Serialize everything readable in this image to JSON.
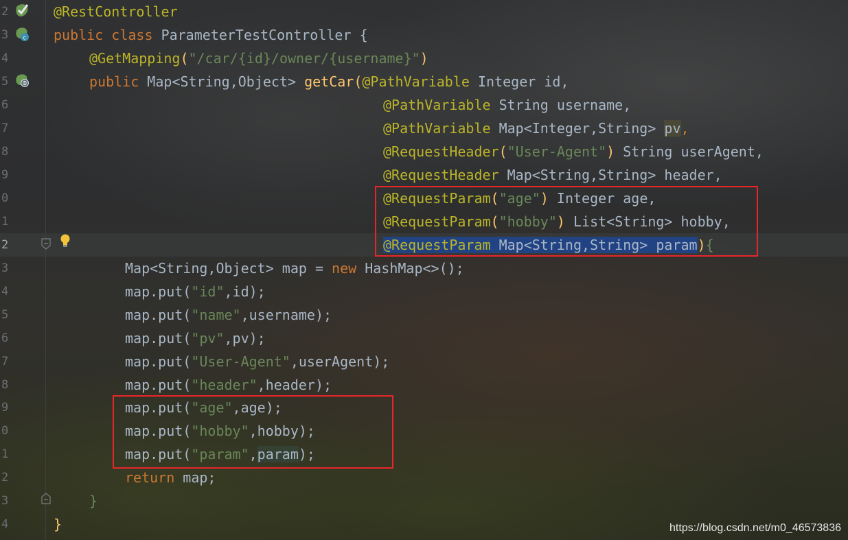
{
  "gutter": {
    "line_numbers": [
      "2",
      "3",
      "4",
      "5",
      "6",
      "7",
      "8",
      "9",
      "0",
      "1",
      "2",
      "3",
      "4",
      "5",
      "6",
      "7",
      "8",
      "9",
      "0",
      "1",
      "2",
      "3",
      "4"
    ]
  },
  "code": {
    "l2": {
      "annot": "@RestController"
    },
    "l3": {
      "kw1": "public",
      "kw2": "class",
      "name": "ParameterTestController",
      "brace": "{"
    },
    "l4": {
      "annot": "@GetMapping",
      "open": "(",
      "str": "\"/car/{id}/owner/{username}\"",
      "close": ")"
    },
    "l5": {
      "kw": "public",
      "type": "Map<String,Object>",
      "fn": "getCar",
      "open": "(",
      "annot": "@PathVariable",
      "rest": "Integer id,"
    },
    "l6": {
      "annot": "@PathVariable",
      "rest": "String username,"
    },
    "l7": {
      "annot": "@PathVariable",
      "type": "Map<Integer,String>",
      "var": "pv",
      "comma": ","
    },
    "l8": {
      "annot": "@RequestHeader",
      "open": "(",
      "str": "\"User-Agent\"",
      "close": ")",
      "rest": "String userAgent,"
    },
    "l9": {
      "annot": "@RequestHeader",
      "rest": "Map<String,String> header,"
    },
    "l10": {
      "annot": "@RequestParam",
      "open": "(",
      "str": "\"age\"",
      "close": ")",
      "rest": "Integer age,"
    },
    "l11": {
      "annot": "@RequestParam",
      "open": "(",
      "str": "\"hobby\"",
      "close": ")",
      "rest": "List<String> hobby,"
    },
    "l12": {
      "annot": "@RequestParam",
      "rest": "Map<String,String> param",
      "close": ")",
      "brace": "{"
    },
    "l13": {
      "pre": "Map<String,Object> map = ",
      "kw": "new",
      "post": "HashMap<>();"
    },
    "l14": {
      "pre": "map.put(",
      "str": "\"id\"",
      "post": ",id);"
    },
    "l15": {
      "pre": "map.put(",
      "str": "\"name\"",
      "post": ",username);"
    },
    "l16": {
      "pre": "map.put(",
      "str": "\"pv\"",
      "post": ",pv);"
    },
    "l17": {
      "pre": "map.put(",
      "str": "\"User-Agent\"",
      "post": ",userAgent);"
    },
    "l18": {
      "pre": "map.put(",
      "str": "\"header\"",
      "post": ",header);"
    },
    "l19": {
      "pre": "map.put(",
      "str": "\"age\"",
      "post": ",age);"
    },
    "l20": {
      "pre": "map.put(",
      "str": "\"hobby\"",
      "post": ",hobby);"
    },
    "l21": {
      "pre": "map.put(",
      "str": "\"param\"",
      "comma": ",",
      "var": "param",
      "post": ");"
    },
    "l22": {
      "kw": "return",
      "post": "map;"
    },
    "l23": {
      "brace": "}"
    },
    "l24": {
      "brace": "}"
    }
  },
  "watermark": "https://blog.csdn.net/m0_46573836",
  "colors": {
    "annotation": "#bbb529",
    "keyword": "#cc7832",
    "string": "#6a8759",
    "function": "#ffc66d",
    "plain": "#a9b7c6",
    "selection": "#214283",
    "highlight_box": "#e8262a"
  },
  "icons": [
    "bean-check-icon",
    "spring-class-icon",
    "web-endpoint-icon",
    "lightbulb-icon",
    "fold-marker-icon"
  ]
}
